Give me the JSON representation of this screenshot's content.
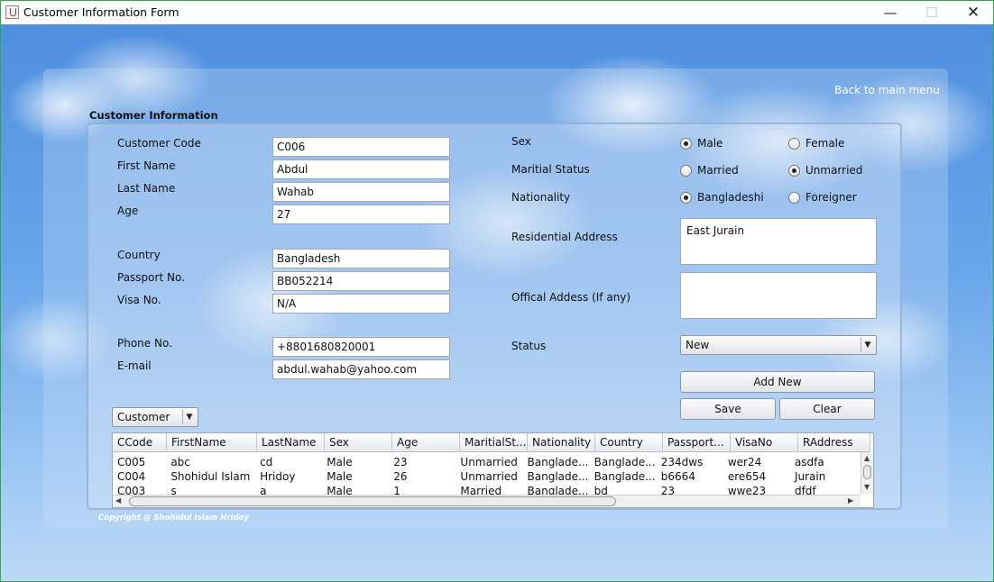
{
  "window": {
    "title": "Customer Information Form",
    "minimize": "—",
    "maximize": "☐",
    "close": "✕"
  },
  "header": {
    "back_link": "Back to main menu",
    "section_title": "Customer Information"
  },
  "labels": {
    "customer_code": "Customer Code",
    "first_name": "First Name",
    "last_name": "Last Name",
    "age": "Age",
    "country": "Country",
    "passport": "Passport No.",
    "visa": "Visa No.",
    "phone": "Phone No.",
    "email": "E-mail",
    "sex": "Sex",
    "marital_status": "Maritial Status",
    "nationality": "Nationality",
    "residential_address": "Residential Address",
    "official_address": "Offical Addess (If any)",
    "status": "Status"
  },
  "fields": {
    "customer_code": "C006",
    "first_name": "Abdul",
    "last_name": "Wahab",
    "age": "27",
    "country": "Bangladesh",
    "passport": "BB052214",
    "visa": "N/A",
    "phone": "+8801680820001",
    "email": "abdul.wahab@yahoo.com",
    "residential_address": "East Jurain",
    "official_address": ""
  },
  "radios": {
    "sex": [
      {
        "label": "Male",
        "selected": true
      },
      {
        "label": "Female",
        "selected": false
      }
    ],
    "marital": [
      {
        "label": "Married",
        "selected": false
      },
      {
        "label": "Unmarried",
        "selected": true
      }
    ],
    "nationality": [
      {
        "label": "Bangladeshi",
        "selected": true
      },
      {
        "label": "Foreigner",
        "selected": false
      }
    ]
  },
  "status_select": {
    "value": "New",
    "arrow": "▼"
  },
  "buttons": {
    "add_new": "Add New",
    "save": "Save",
    "clear": "Clear"
  },
  "filter_select": {
    "value": "Customer",
    "arrow": "▼"
  },
  "table": {
    "columns": [
      "CCode",
      "FirstName",
      "LastName",
      "Sex",
      "Age",
      "MaritialSt...",
      "Nationality",
      "Country",
      "Passport...",
      "VisaNo",
      "RAddress"
    ],
    "rows": [
      [
        "C005",
        "abc",
        "cd",
        "Male",
        "23",
        "Unmarried",
        "Banglade...",
        "Banglade...",
        "234dws",
        "wer24",
        "asdfa"
      ],
      [
        "C004",
        "Shohidul Islam",
        "Hridoy",
        "Male",
        "26",
        "Unmarried",
        "Banglade...",
        "Banglade...",
        "b6664",
        "ere654",
        "Jurain"
      ],
      [
        "C003",
        "s",
        "a",
        "Male",
        "1",
        "Married",
        "Banglade...",
        "bd",
        "23",
        "wwe23",
        "dfdf"
      ]
    ]
  },
  "scroll_arrows": {
    "up": "▲",
    "down": "▼",
    "left": "◀",
    "right": "▶"
  },
  "footer": {
    "copyright": "Copyright @ Shohidul Islam Hridoy"
  }
}
